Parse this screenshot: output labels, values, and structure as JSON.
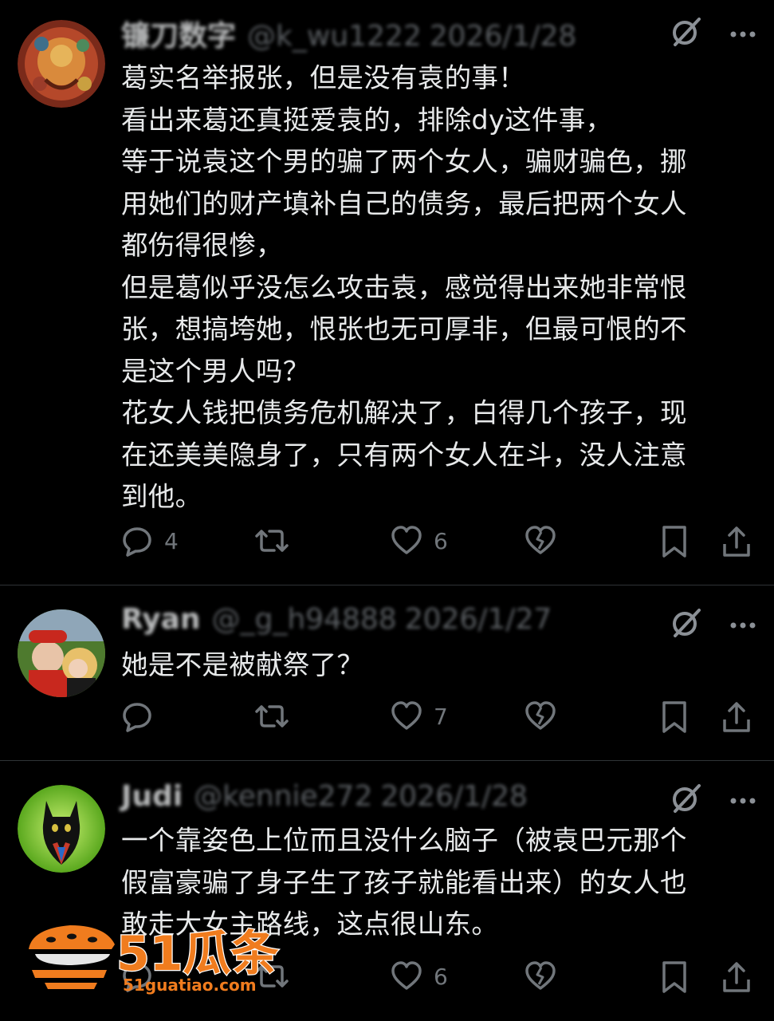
{
  "posts": [
    {
      "name": "镰刀数字",
      "handle": "@k_wu1222",
      "date": "2026/1/28",
      "text": "葛实名举报张，但是没有袁的事！\n看出来葛还真挺爱袁的，排除dy这件事，\n等于说袁这个男的骗了两个女人，骗财骗色，挪\n用她们的财产填补自己的债务，最后把两个女人\n都伤得很惨，\n但是葛似乎没怎么攻击袁，感觉得出来她非常恨\n张，想搞垮她，恨张也无可厚非，但最可恨的不\n是这个男人吗？\n花女人钱把债务危机解决了，白得几个孩子，现\n在还美美隐身了，只有两个女人在斗，没人注意\n到他。",
      "replies": "4",
      "reposts": "",
      "likes": "6"
    },
    {
      "name": "Ryan",
      "handle": "@_g_h94888",
      "date": "2026/1/27",
      "text": "她是不是被献祭了？",
      "replies": "",
      "reposts": "",
      "likes": "7"
    },
    {
      "name": "Judi",
      "handle": "@kennie272",
      "date": "2026/1/28",
      "text": "一个靠姿色上位而且没什么脑子（被袁巴元那个\n假富豪骗了身子生了孩子就能看出来）的女人也\n敢走大女主路线，这点很山东。",
      "replies": "",
      "reposts": "",
      "likes": "6"
    }
  ],
  "icons": {
    "grok": "grok-icon",
    "more": "more-icon",
    "reply": "reply-icon",
    "repost": "repost-icon",
    "like": "heart-icon",
    "dislike": "broken-heart-icon",
    "bookmark": "bookmark-icon",
    "share": "share-icon"
  },
  "watermark": {
    "brand": "51瓜条",
    "site": "51guatiao.com"
  },
  "colors": {
    "background": "#000000",
    "text": "#e7e9ea",
    "muted": "#71767b",
    "divider": "#2f3336",
    "watermark": "#f07c1e"
  }
}
